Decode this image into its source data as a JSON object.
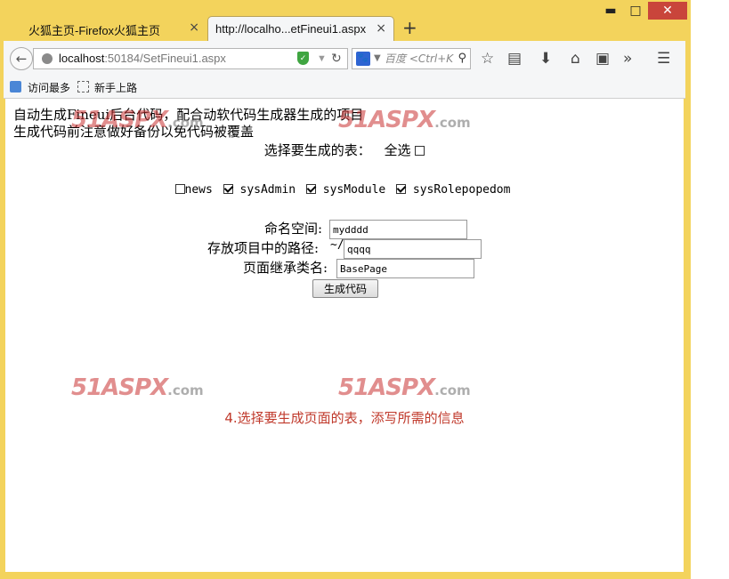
{
  "browser": {
    "tabs": [
      {
        "label": "火狐主页-Firefox火狐主页",
        "close": "×"
      },
      {
        "label": "http://localho...etFineui1.aspx",
        "close": "×"
      }
    ],
    "new_tab": "+",
    "window_controls": {
      "minimize": "▬",
      "maximize": "□",
      "close": "✕"
    },
    "url": {
      "host": "localhost",
      "rest": ":50184/SetFineui1.aspx"
    },
    "search_placeholder": "百度 <Ctrl+K",
    "bookmarks": [
      "访问最多",
      "新手上路"
    ],
    "icons": [
      "back-icon",
      "globe-icon",
      "shield-icon",
      "reload-icon",
      "baidu-icon",
      "search-icon",
      "star-icon",
      "reading-list-icon",
      "download-icon",
      "home-icon",
      "pocket-icon",
      "overflow-icon",
      "menu-icon"
    ]
  },
  "page": {
    "intro_line1": "自动生成Fineui后台代码，配合动软代码生成器生成的项目",
    "intro_line2": "生成代码前注意做好备份以免代码被覆盖",
    "choose_label": "选择要生成的表：",
    "select_all_label": "全选",
    "select_all_checked": false,
    "tables": [
      {
        "name": "news",
        "checked": false
      },
      {
        "name": "sysAdmin",
        "checked": true
      },
      {
        "name": "sysModule",
        "checked": true
      },
      {
        "name": "sysRolepopedom",
        "checked": true
      }
    ],
    "namespace_label": "命名空间:",
    "namespace_value": "mydddd",
    "path_label": "存放项目中的路径:",
    "path_prefix": "~/",
    "path_value": "qqqq",
    "base_class_label": "页面继承类名:",
    "base_class_value": "BasePage",
    "generate_button": "生成代码",
    "caption": "4.选择要生成页面的表，添写所需的信息",
    "watermark_main": "51ASPX",
    "watermark_suffix": ".com"
  }
}
